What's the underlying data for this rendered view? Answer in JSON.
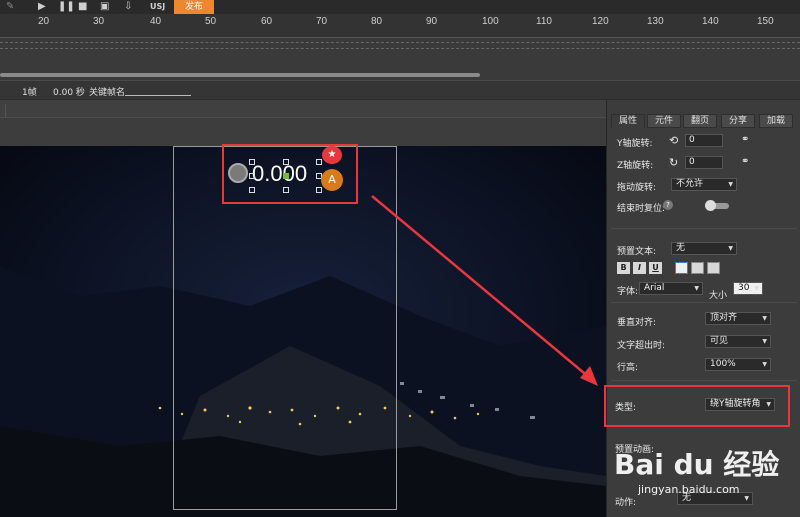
{
  "toolbar": {
    "publish_label": "发布",
    "usj_label": "USJ"
  },
  "ruler": {
    "ticks": [
      "20",
      "30",
      "40",
      "50",
      "60",
      "70",
      "80",
      "90",
      "100",
      "110",
      "120",
      "130",
      "140",
      "150"
    ]
  },
  "frame_info": {
    "frame": "1帧",
    "seconds": "0.00 秒",
    "keyframe_label": "关键帧名"
  },
  "canvas": {
    "counter_value": "0.000",
    "star_badge": "★",
    "text_badge": "A"
  },
  "panel": {
    "tabs": [
      "属性",
      "元件",
      "翻页",
      "分享",
      "加载"
    ],
    "y_rotate_label": "Y轴旋转:",
    "y_rotate_value": "0",
    "z_rotate_label": "Z轴旋转:",
    "z_rotate_value": "0",
    "drag_rotate_label": "拖动旋转:",
    "drag_rotate_value": "不允许",
    "reset_on_end_label": "结束时复位:",
    "preset_text_label": "预置文本:",
    "preset_text_value": "无",
    "bold_label": "B",
    "italic_label": "I",
    "underline_label": "U",
    "font_label": "字体:",
    "font_value": "Arial",
    "size_label": "大小",
    "size_value": "30",
    "valign_label": "垂直对齐:",
    "valign_value": "顶对齐",
    "overflow_label": "文字超出时:",
    "overflow_value": "可见",
    "line_height_label": "行高:",
    "line_height_value": "100%",
    "type_label": "类型:",
    "type_value": "绕Y轴旋转角",
    "preset_anim_label": "预置动画:",
    "action_label": "动作:",
    "action_value": "无"
  },
  "watermark": {
    "brand": "Bai du 经验",
    "url": "jingyan.baidu.com"
  },
  "colors": {
    "accent_orange": "#f0862d",
    "highlight_red": "#e8383d"
  }
}
